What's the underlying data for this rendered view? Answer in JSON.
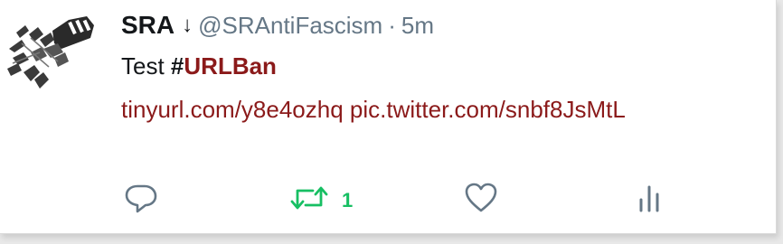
{
  "tweet": {
    "display_name": "SRA",
    "badge_glyph": "↓",
    "handle": "@SRAntiFascism",
    "separator": "·",
    "timestamp": "5m",
    "text_prefix": "Test ",
    "hashtag_symbol": "#",
    "hashtag_word": "URLBan",
    "link_1": "tinyurl.com/y8e4ozhq",
    "link_2": "pic.twitter.com/snbf8JsMtL"
  },
  "actions": {
    "reply_icon": "reply-bubble-icon",
    "retweet_icon": "retweet-icon",
    "retweet_count": "1",
    "like_icon": "heart-icon",
    "analytics_icon": "bar-chart-icon"
  },
  "colors": {
    "hashtag": "#8b1a1a",
    "link": "#8b1a1a",
    "retweet_active": "#17bf63",
    "muted": "#657786"
  }
}
